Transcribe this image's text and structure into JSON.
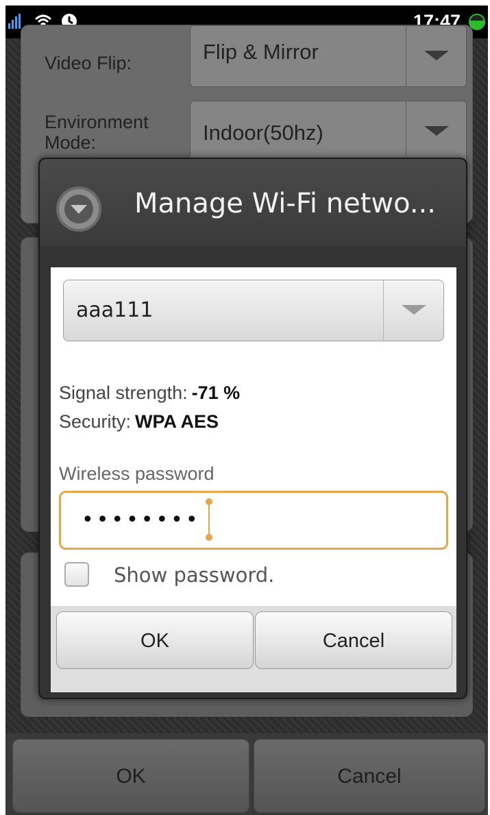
{
  "status_bar": {
    "time": "17:47",
    "icons": [
      "signal-bars-icon",
      "wifi-icon",
      "clock-badge-icon",
      "battery-icon"
    ]
  },
  "background_settings": {
    "video_flip": {
      "label": "Video Flip:",
      "value": "Flip & Mirror"
    },
    "environment_mode": {
      "label": "Environment Mode:",
      "label_line1": "Environment",
      "label_line2": "Mode:",
      "value": "Indoor(50hz)"
    }
  },
  "dialog": {
    "title": "Manage Wi-Fi netwo...",
    "network_select": {
      "value": "aaa111"
    },
    "signal_strength": {
      "label": "Signal strength:",
      "value": "-71 %"
    },
    "security": {
      "label": "Security:",
      "value": "WPA AES"
    },
    "password": {
      "label": "Wireless password",
      "masked_value": "••••••••"
    },
    "show_password": {
      "label": "Show password.",
      "checked": false
    },
    "buttons": {
      "ok": "OK",
      "cancel": "Cancel"
    }
  },
  "bottom_bar": {
    "ok": "OK",
    "cancel": "Cancel"
  },
  "colors": {
    "accent": "#e8a445",
    "battery": "#2dbb2d"
  }
}
